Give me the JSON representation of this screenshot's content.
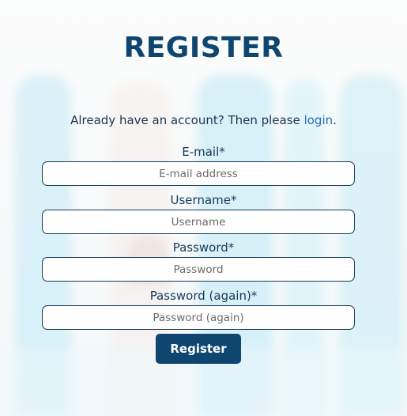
{
  "page": {
    "title": "REGISTER"
  },
  "intro": {
    "text": "Already have an account? Then please ",
    "link_label": "login",
    "suffix": "."
  },
  "form": {
    "email": {
      "label": "E-mail*",
      "placeholder": "E-mail address",
      "value": ""
    },
    "username": {
      "label": "Username*",
      "placeholder": "Username",
      "value": ""
    },
    "password": {
      "label": "Password*",
      "placeholder": "Password",
      "value": ""
    },
    "password_again": {
      "label": "Password (again)*",
      "placeholder": "Password (again)",
      "value": ""
    },
    "submit_label": "Register"
  },
  "colors": {
    "brand": "#0e4670",
    "link": "#2a6db5",
    "text": "#163a5c"
  }
}
